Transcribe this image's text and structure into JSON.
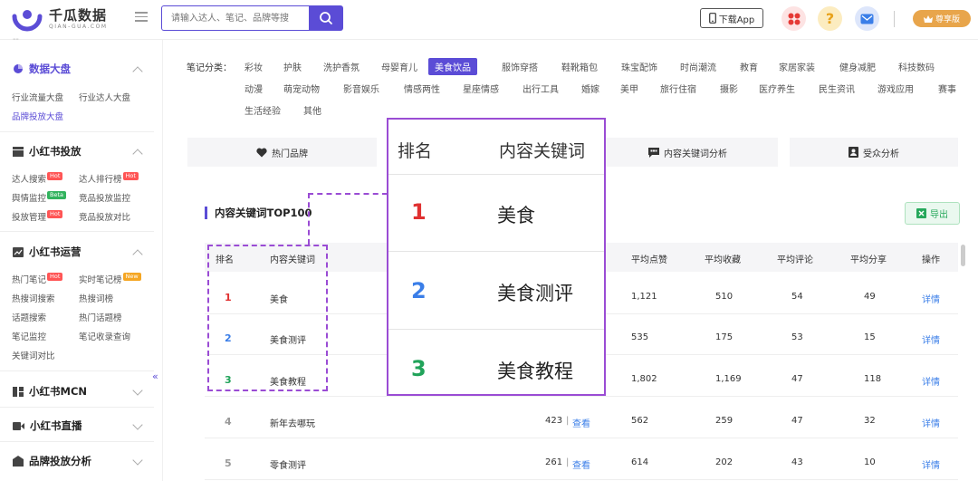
{
  "brand": {
    "name": "千瓜数据",
    "sub": "QIAN-GUA.COM"
  },
  "search": {
    "placeholder": "请输入达人、笔记、品牌等搜"
  },
  "header": {
    "download_label": "下载App",
    "vip_label": "尊享版"
  },
  "colors": {
    "accent": "#5b4cd6",
    "rank1": "#e03131",
    "rank2": "#3a7ee8",
    "rank3": "#21a35a",
    "highlight": "#9a4cd4",
    "link": "#3a7ee8"
  },
  "sidebar": {
    "top_fragment": "--",
    "sections": [
      {
        "title": "数据大盘",
        "icon": "pie-chart-icon",
        "expanded": true,
        "items": [
          {
            "label": "行业流量大盘"
          },
          {
            "label": "行业达人大盘"
          },
          {
            "label": "品牌投放大盘",
            "active": true
          }
        ]
      },
      {
        "title": "小红书投放",
        "icon": "list-icon",
        "expanded": true,
        "items": [
          {
            "label": "达人搜索",
            "badge": "Hot"
          },
          {
            "label": "达人排行榜",
            "badge": "Hot"
          },
          {
            "label": "舆情监控",
            "badge": "Beta"
          },
          {
            "label": "竞品投放监控"
          },
          {
            "label": "投放管理",
            "badge": "Hot"
          },
          {
            "label": "竞品投放对比"
          }
        ]
      },
      {
        "title": "小红书运营",
        "icon": "chart-icon",
        "expanded": true,
        "items": [
          {
            "label": "热门笔记",
            "badge": "Hot"
          },
          {
            "label": "实时笔记榜",
            "badge": "New"
          },
          {
            "label": "热搜词搜索"
          },
          {
            "label": "热搜词榜"
          },
          {
            "label": "话题搜索"
          },
          {
            "label": "热门话题榜"
          },
          {
            "label": "笔记监控"
          },
          {
            "label": "笔记收录查询"
          },
          {
            "label": "关键词对比"
          }
        ]
      },
      {
        "title": "小红书MCN",
        "icon": "mcn-icon",
        "expanded": false
      },
      {
        "title": "小红书直播",
        "icon": "live-icon",
        "expanded": false
      },
      {
        "title": "品牌投放分析",
        "icon": "brand-icon",
        "expanded": false
      }
    ]
  },
  "categories": {
    "label": "笔记分类：",
    "items": [
      "彩妆",
      "护肤",
      "洗护香氛",
      "母婴育儿",
      "美食饮品",
      "服饰穿搭",
      "鞋靴箱包",
      "珠宝配饰",
      "时尚潮流",
      "教育",
      "家居家装",
      "健身减肥",
      "科技数码",
      "动漫",
      "萌宠动物",
      "影音娱乐",
      "情感两性",
      "星座情感",
      "出行工具",
      "婚嫁",
      "美甲",
      "旅行住宿",
      "摄影",
      "医疗养生",
      "民生资讯",
      "游戏应用",
      "赛事",
      "生活经验",
      "其他"
    ],
    "active": "美食饮品"
  },
  "tabs": [
    {
      "label": "热门品牌",
      "icon": "heart-icon"
    },
    {
      "label": "",
      "icon": ""
    },
    {
      "label": "内容关键词分析",
      "icon": "comment-icon"
    },
    {
      "label": "受众分析",
      "icon": "user-icon"
    }
  ],
  "table": {
    "title": "内容关键词TOP100",
    "export_label": "导出",
    "headers": [
      "排名",
      "内容关键词",
      "平均点赞",
      "平均收藏",
      "平均评论",
      "平均分享",
      "操作"
    ],
    "rows": [
      {
        "rank": "1",
        "keyword": "美食",
        "notes": "",
        "likes": "1,121",
        "favs": "510",
        "comments": "54",
        "shares": "49",
        "action": "详情"
      },
      {
        "rank": "2",
        "keyword": "美食测评",
        "notes": "",
        "likes": "535",
        "favs": "175",
        "comments": "53",
        "shares": "15",
        "action": "详情"
      },
      {
        "rank": "3",
        "keyword": "美食教程",
        "notes": "",
        "likes": "1,802",
        "favs": "1,169",
        "comments": "47",
        "shares": "118",
        "action": "详情"
      },
      {
        "rank": "4",
        "keyword": "新年去哪玩",
        "notes": "423",
        "view": "查看",
        "likes": "562",
        "favs": "259",
        "comments": "47",
        "shares": "32",
        "action": "详情"
      },
      {
        "rank": "5",
        "keyword": "零食测评",
        "notes": "261",
        "view": "查看",
        "likes": "614",
        "favs": "202",
        "comments": "43",
        "shares": "10",
        "action": "详情"
      }
    ]
  },
  "zoom": {
    "headers": [
      "排名",
      "内容关键词"
    ],
    "rows": [
      {
        "rank": "1",
        "keyword": "美食"
      },
      {
        "rank": "2",
        "keyword": "美食测评"
      },
      {
        "rank": "3",
        "keyword": "美食教程"
      }
    ]
  }
}
